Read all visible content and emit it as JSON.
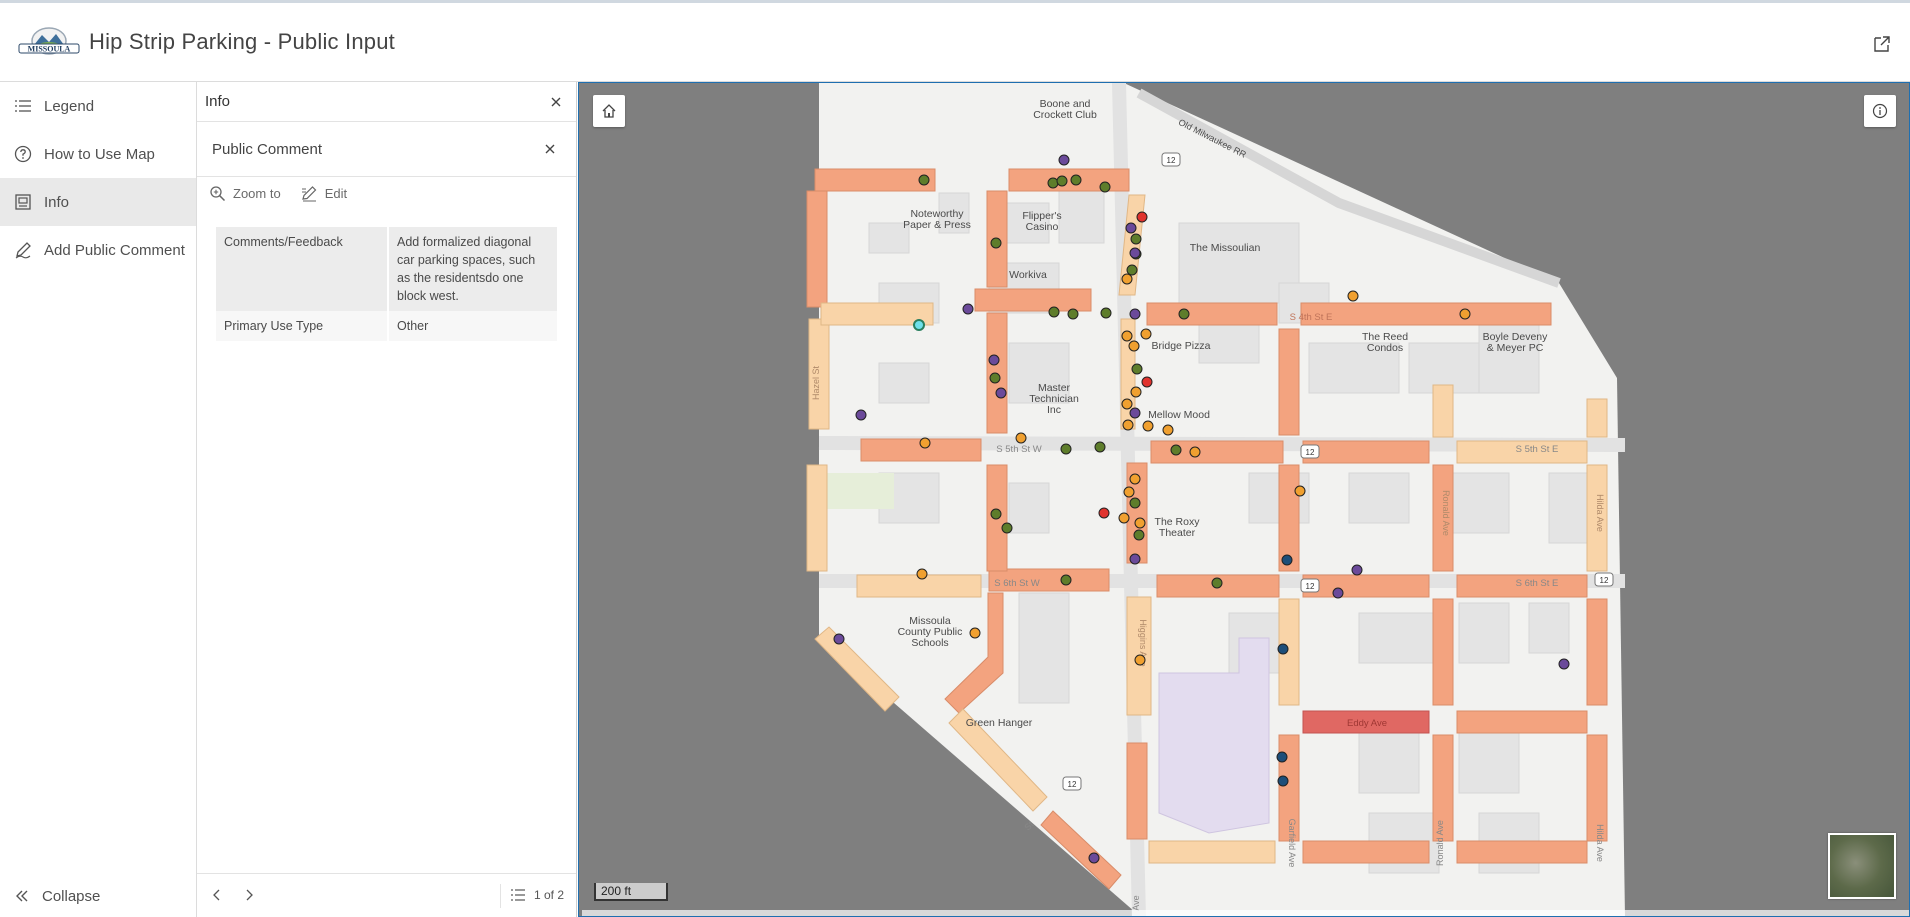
{
  "header": {
    "logo_text": "MISSOULA",
    "title": "Hip Strip Parking - Public Input"
  },
  "nav": {
    "items": [
      {
        "label": "Legend",
        "icon": "list-icon"
      },
      {
        "label": "How to Use Map",
        "icon": "help-icon"
      },
      {
        "label": "Info",
        "icon": "info-panel-icon",
        "active": true
      },
      {
        "label": "Add Public Comment",
        "icon": "edit-icon"
      }
    ],
    "collapse_label": "Collapse"
  },
  "info": {
    "title": "Info",
    "feature_title": "Public Comment",
    "zoom_label": "Zoom to",
    "edit_label": "Edit",
    "attributes": [
      {
        "key": "Comments/Feedback",
        "value": "Add formalized diagonal car parking spaces, such as the residentsdo one block west."
      },
      {
        "key": "Primary Use Type",
        "value": "Other"
      }
    ],
    "pagination": "1 of 2"
  },
  "map": {
    "scale_label": "200 ft",
    "labels": {
      "boone": "Boone and\nCrockett Club",
      "noteworthy": "Noteworthy\nPaper & Press",
      "flippers": "Flipper's\nCasino",
      "missoulian": "The Missoulian",
      "workiva": "Workiva",
      "reed": "The Reed\nCondos",
      "boyle": "Boyle Deveny\n& Meyer PC",
      "bridge": "Bridge Pizza",
      "master": "Master\nTechnician\nInc",
      "mellow": "Mellow Mood",
      "roxy": "The Roxy\nTheater",
      "mcps": "Missoula\nCounty Public\nSchools",
      "green": "Green Hanger",
      "milwaukee": "Old Milwaukee RR",
      "s4th": "S 4th St E",
      "s5thw": "S 5th St W",
      "s5the": "S 5th St E",
      "s6thw": "S 6th St W",
      "s6the": "S 6th St E",
      "eddy": "Eddy Ave",
      "hazel": "Hazel St",
      "higgins": "Higgins Ave",
      "ronald": "Ronald Ave",
      "hilda": "Hilda Ave",
      "garfield": "Garfield Ave",
      "st": "St",
      "ave": "Ave",
      "hwy12": "12"
    },
    "colors": {
      "orange_segment": "#f3a37f",
      "light_segment": "#f9d4a8",
      "red_segment": "#e06863",
      "green_point": "#5e7d2b",
      "purple_point": "#6b4a9a",
      "orange_point": "#f0a030",
      "red_point": "#e0332e",
      "blue_point": "#1e4e79",
      "cyan_point": "#6fe0ea"
    }
  }
}
